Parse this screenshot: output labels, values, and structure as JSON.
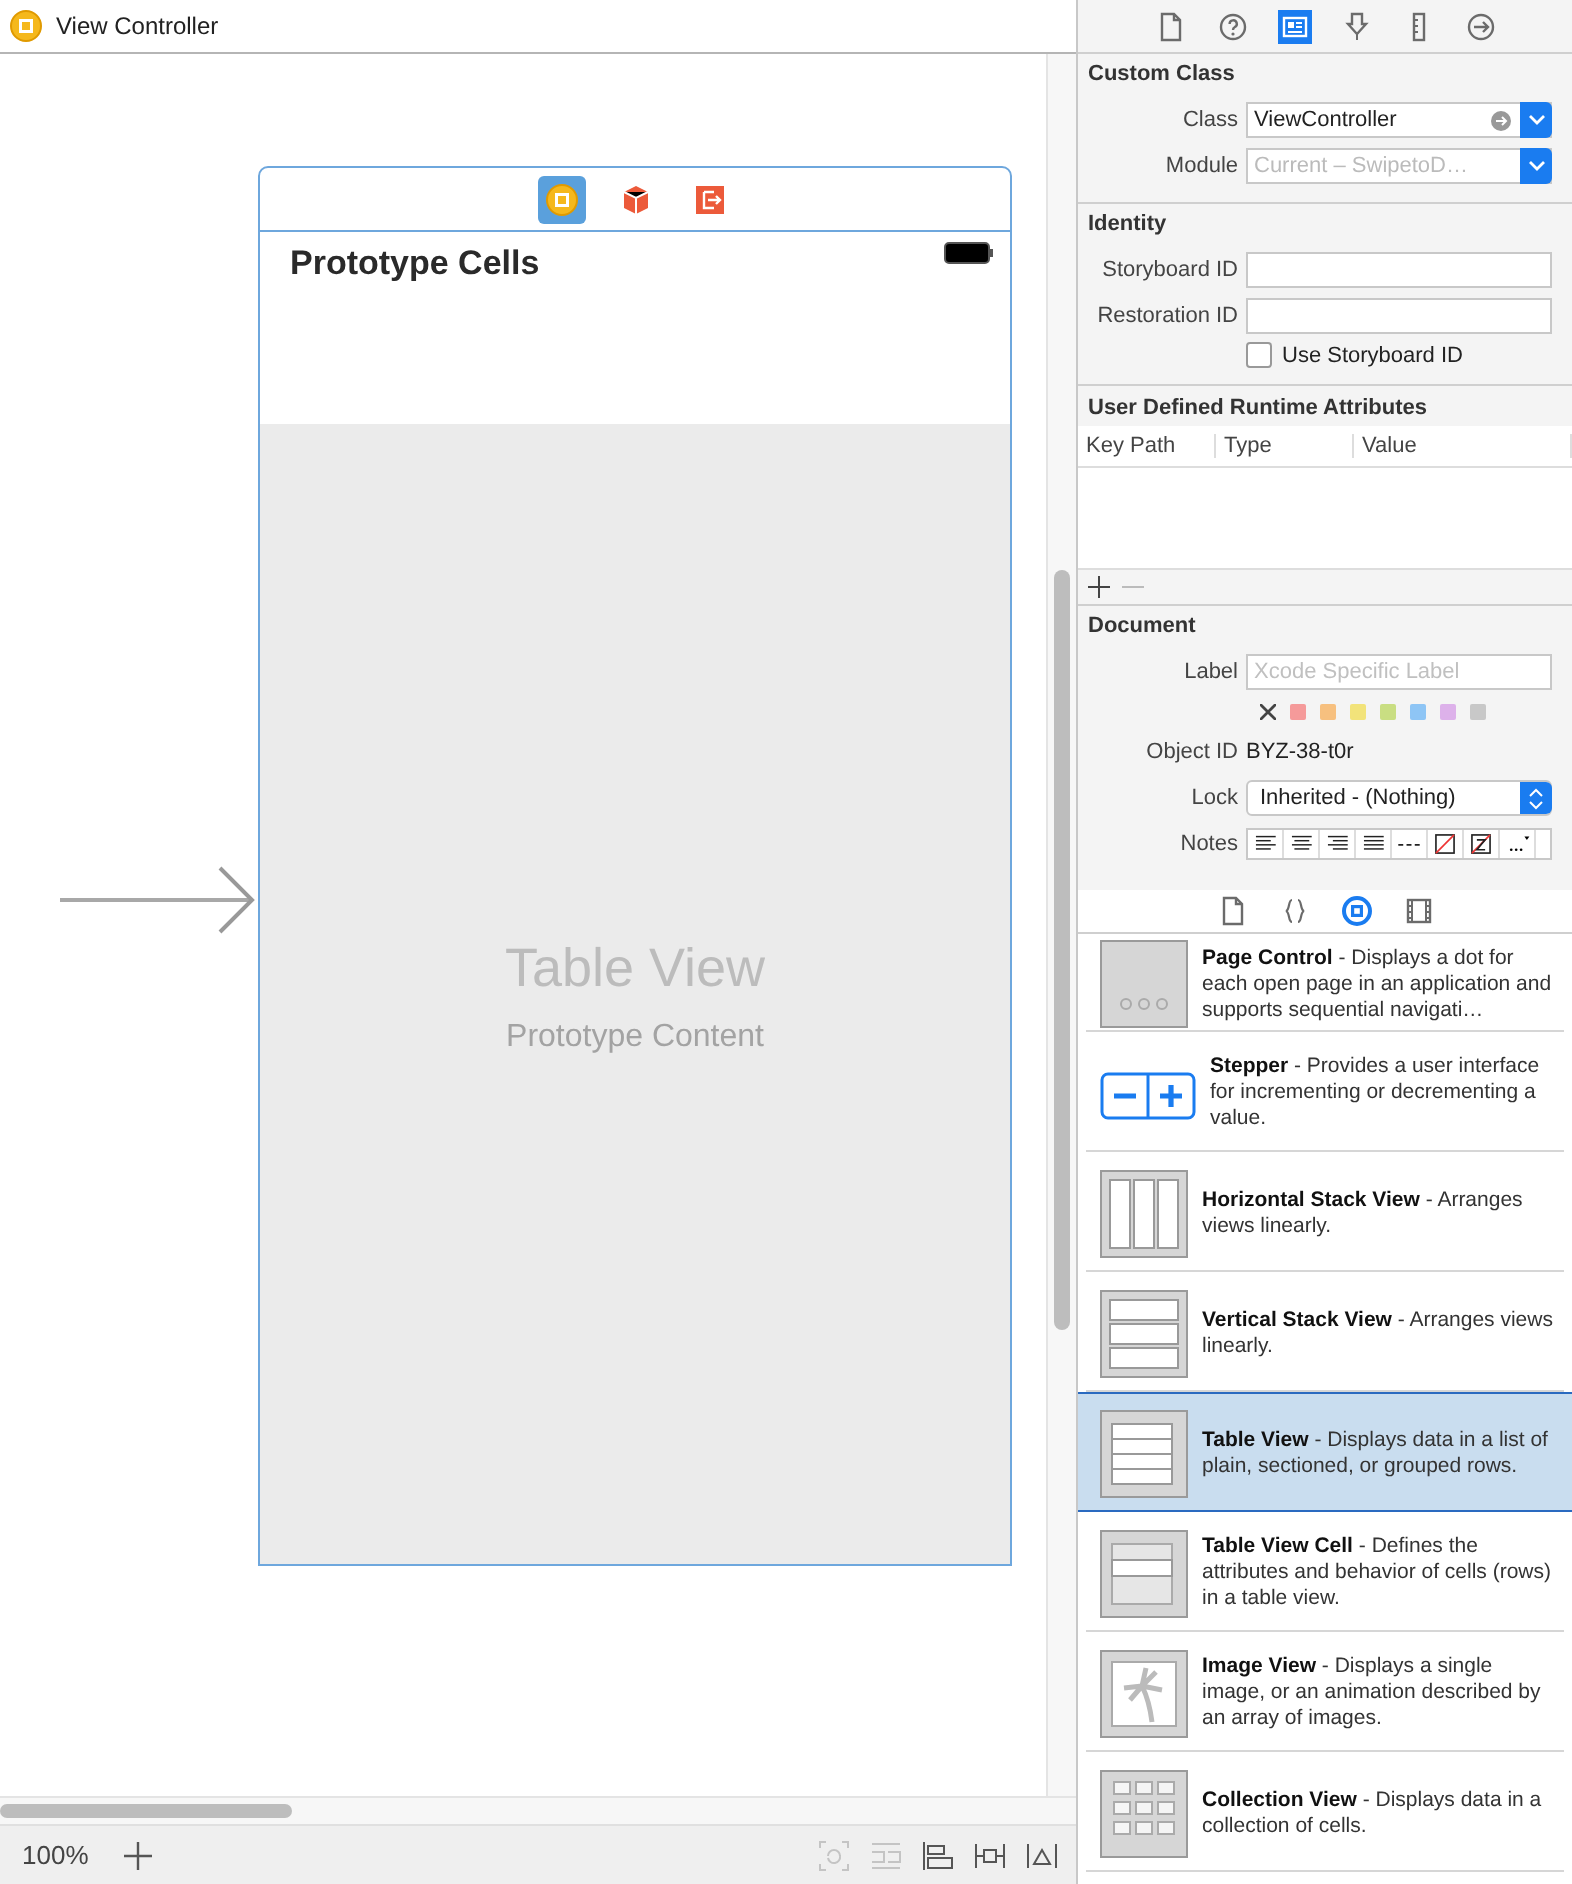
{
  "canvas": {
    "title": "View Controller",
    "scene": {
      "dock": [
        {
          "kind": "controller",
          "selected": true
        },
        {
          "kind": "cube",
          "selected": false
        },
        {
          "kind": "exit",
          "selected": false
        }
      ],
      "header": "Prototype Cells",
      "table_title": "Table View",
      "table_subtitle": "Prototype Content"
    },
    "zoom": "100%",
    "bottom_tools": [
      {
        "kind": "refresh",
        "disabled": true
      },
      {
        "kind": "stack",
        "disabled": true
      },
      {
        "kind": "align",
        "disabled": false
      },
      {
        "kind": "pin",
        "disabled": false
      },
      {
        "kind": "resolve",
        "disabled": false
      }
    ]
  },
  "inspector": {
    "tabs": [
      {
        "kind": "file",
        "selected": false
      },
      {
        "kind": "help",
        "selected": false
      },
      {
        "kind": "identity",
        "selected": true
      },
      {
        "kind": "attributes",
        "selected": false
      },
      {
        "kind": "size",
        "selected": false
      },
      {
        "kind": "connections",
        "selected": false
      }
    ],
    "custom_class": {
      "heading": "Custom Class",
      "class_label": "Class",
      "class_value": "ViewController",
      "module_label": "Module",
      "module_placeholder": "Current – SwipetoD…"
    },
    "identity": {
      "heading": "Identity",
      "storyboard_label": "Storyboard ID",
      "restoration_label": "Restoration ID",
      "use_storyboard": {
        "label": "Use Storyboard ID",
        "checked": false
      }
    },
    "runtime_attributes": {
      "heading": "User Defined Runtime Attributes",
      "columns": [
        "Key Path",
        "Type",
        "Value"
      ]
    },
    "document": {
      "heading": "Document",
      "label_label": "Label",
      "label_placeholder": "Xcode Specific Label",
      "colors": [
        {
          "color": "#f59a9a"
        },
        {
          "color": "#f7c07f"
        },
        {
          "color": "#f2e37a"
        },
        {
          "color": "#c9de82"
        },
        {
          "color": "#8ec5f5"
        },
        {
          "color": "#ddb1ea"
        },
        {
          "color": "#c8c8c8"
        }
      ],
      "object_id_label": "Object ID",
      "object_id": "BYZ-38-t0r",
      "lock_label": "Lock",
      "lock_value": "Inherited - (Nothing)",
      "notes_label": "Notes"
    }
  },
  "library": {
    "tabs": [
      {
        "kind": "file",
        "selected": false
      },
      {
        "kind": "code",
        "selected": false
      },
      {
        "kind": "object",
        "selected": true
      },
      {
        "kind": "media",
        "selected": false
      }
    ],
    "items": [
      {
        "kind": "page_control",
        "text": "**Page Control** - Displays a dot for each open page in an application and supports sequential navigati…",
        "selected": false
      },
      {
        "kind": "stepper",
        "text": "**Stepper** - Provides a user interface for incrementing or decrementing a value.",
        "selected": false
      },
      {
        "kind": "hstack",
        "text": "**Horizontal Stack View** - Arranges views linearly.",
        "selected": false
      },
      {
        "kind": "vstack",
        "text": "**Vertical Stack View** - Arranges views linearly.",
        "selected": false
      },
      {
        "kind": "table",
        "text": "**Table View** - Displays data in a list of plain, sectioned, or grouped rows.",
        "selected": true
      },
      {
        "kind": "table_cell",
        "text": "**Table View Cell** - Defines the attributes and behavior of cells (rows) in a table view.",
        "selected": false
      },
      {
        "kind": "image",
        "text": "**Image View** - Displays a single image, or an animation described by an array of images.",
        "selected": false
      },
      {
        "kind": "collection",
        "text": "**Collection View** - Displays data in a collection of cells.",
        "selected": false
      }
    ]
  }
}
